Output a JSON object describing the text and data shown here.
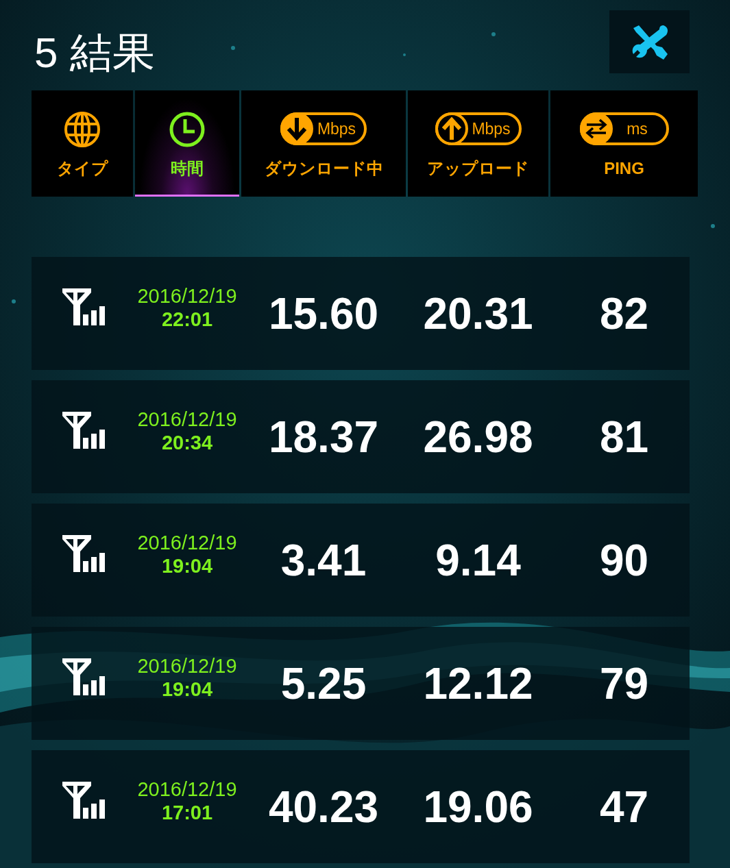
{
  "header": {
    "title": "5 結果"
  },
  "tabs": [
    {
      "kind": "type",
      "label": "タイプ",
      "selected": false
    },
    {
      "kind": "time",
      "label": "時間",
      "selected": true
    },
    {
      "kind": "download",
      "unit": "Mbps",
      "label": "ダウンロード中",
      "selected": false
    },
    {
      "kind": "upload",
      "unit": "Mbps",
      "label": "アップロード",
      "selected": false
    },
    {
      "kind": "ping",
      "unit": "ms",
      "label": "PING",
      "selected": false
    }
  ],
  "results": [
    {
      "date": "2016/12/19",
      "time": "22:01",
      "download": "15.60",
      "upload": "20.31",
      "ping": "82"
    },
    {
      "date": "2016/12/19",
      "time": "20:34",
      "download": "18.37",
      "upload": "26.98",
      "ping": "81"
    },
    {
      "date": "2016/12/19",
      "time": "19:04",
      "download": "3.41",
      "upload": "9.14",
      "ping": "90"
    },
    {
      "date": "2016/12/19",
      "time": "19:04",
      "download": "5.25",
      "upload": "12.12",
      "ping": "79"
    },
    {
      "date": "2016/12/19",
      "time": "17:01",
      "download": "40.23",
      "upload": "19.06",
      "ping": "47"
    }
  ]
}
